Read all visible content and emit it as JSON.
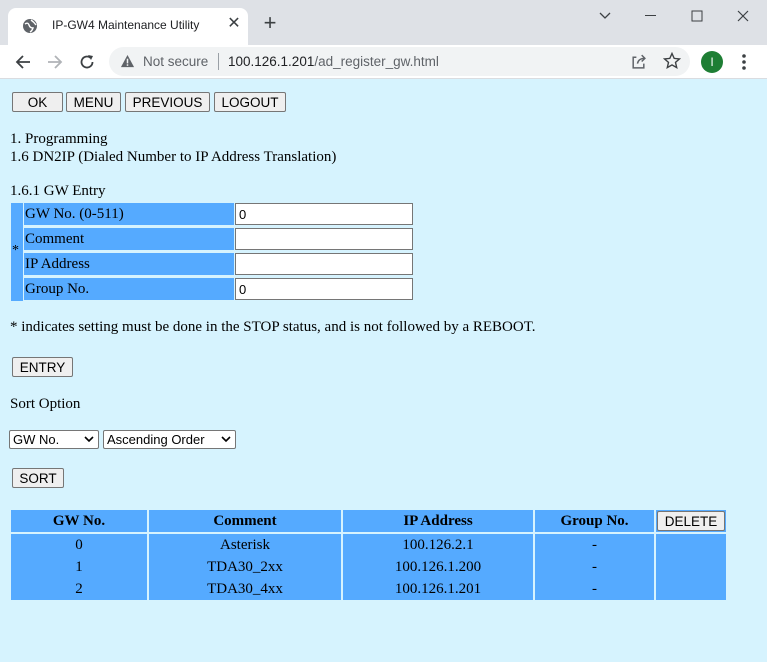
{
  "browser": {
    "tab_title": "IP-GW4 Maintenance Utility",
    "not_secure": "Not secure",
    "url_host": "100.126.1.201",
    "url_path": "/ad_register_gw.html",
    "avatar_initial": "I"
  },
  "nav_buttons": [
    "OK",
    "MENU",
    "PREVIOUS",
    "LOGOUT"
  ],
  "heading1": "1. Programming",
  "heading2": "1.6 DN2IP (Dialed Number to IP Address Translation)",
  "section": "1.6.1 GW Entry",
  "required_mark": "*",
  "fields": [
    {
      "label": "GW No. (0-511)",
      "value": "0"
    },
    {
      "label": "Comment",
      "value": ""
    },
    {
      "label": "IP Address",
      "value": ""
    },
    {
      "label": "Group No.",
      "value": "0"
    }
  ],
  "note": "* indicates setting must be done in the STOP status, and is not followed by a REBOOT.",
  "entry_button": "ENTRY",
  "sort_label": "Sort Option",
  "sort_field": "GW No.",
  "sort_order": "Ascending Order",
  "sort_button": "SORT",
  "table": {
    "headers": [
      "GW No.",
      "Comment",
      "IP Address",
      "Group No."
    ],
    "delete_button": "DELETE",
    "rows": [
      [
        "0",
        "Asterisk",
        "100.126.2.1",
        "-"
      ],
      [
        "1",
        "TDA30_2xx",
        "100.126.1.200",
        "-"
      ],
      [
        "2",
        "TDA30_4xx",
        "100.126.1.201",
        "-"
      ]
    ]
  },
  "colors": {
    "page_bg": "#d6f3fe",
    "cell_bg": "#55aaff"
  }
}
